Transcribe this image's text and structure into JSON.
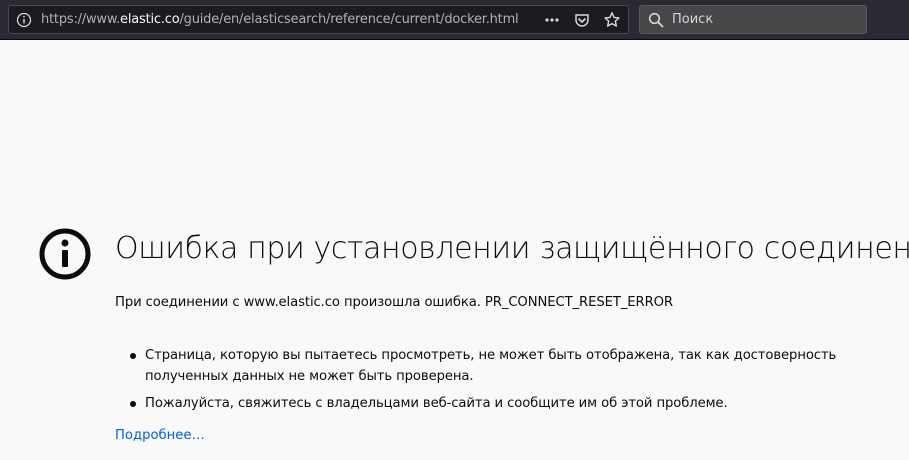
{
  "toolbar": {
    "url_prefix": "https://www.",
    "url_domain": "elastic.co",
    "url_path": "/guide/en/elasticsearch/reference/current/docker.html",
    "search_placeholder": "Поиск",
    "page_actions_label": "•••"
  },
  "error": {
    "title": "Ошибка при установлении защищённого соединения",
    "description": "При соединении с www.elastic.co произошла ошибка. PR_CONNECT_RESET_ERROR",
    "bullets": [
      "Страница, которую вы пытаетесь просмотреть, не может быть отображена, так как достоверность полученных данных не может быть проверена.",
      "Пожалуйста, свяжитесь с владельцами веб-сайта и сообщите им об этой проблеме."
    ],
    "learn_more": "Подробнее…"
  },
  "colors": {
    "toolbar_bg": "#2b2a33",
    "page_bg": "#f9f9fa",
    "link": "#0060df"
  }
}
